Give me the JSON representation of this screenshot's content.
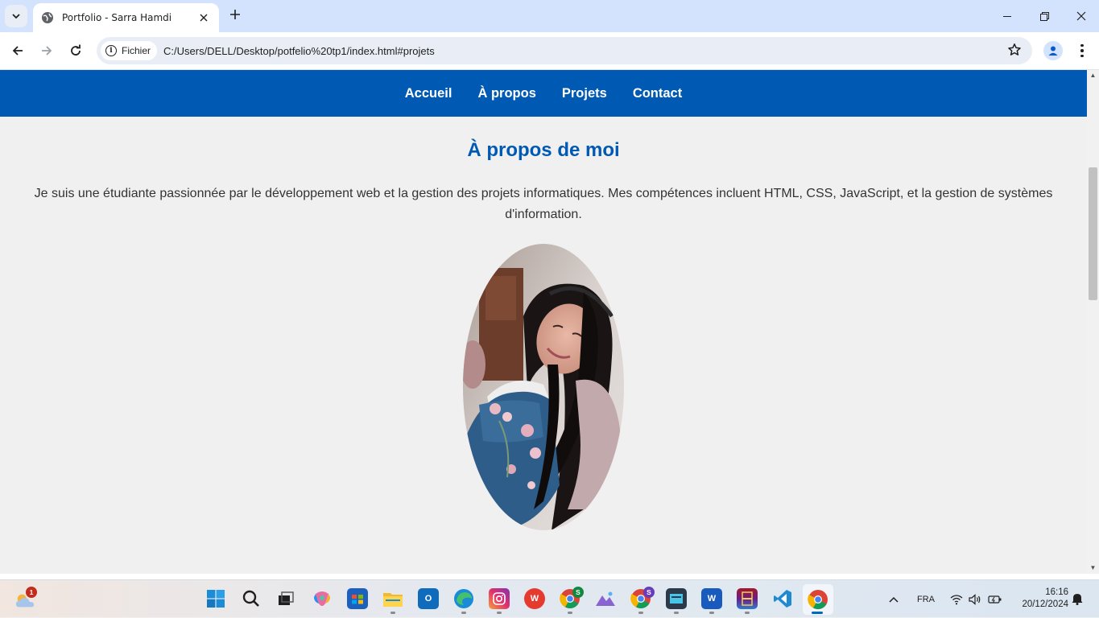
{
  "browser": {
    "tab_title": "Portfolio - Sarra Hamdi",
    "security_chip_label": "Fichier",
    "url": "C:/Users/DELL/Desktop/potfelio%20tp1/index.html#projets"
  },
  "site": {
    "nav": [
      "Accueil",
      "À propos",
      "Projets",
      "Contact"
    ],
    "about_title": "À propos de moi",
    "about_text": "Je suis une étudiante passionnée par le développement web et la gestion des projets informatiques. Mes compétences incluent HTML, CSS, JavaScript, et la gestion de systèmes d'information.",
    "colors": {
      "primary": "#0059b3",
      "background": "#f0f0f0",
      "text": "#333333"
    }
  },
  "taskbar": {
    "weather_badge": "1",
    "skype_badge_1": "S",
    "skype_badge_2": "S",
    "language": "FRA",
    "time": "16:16",
    "date": "20/12/2024"
  }
}
